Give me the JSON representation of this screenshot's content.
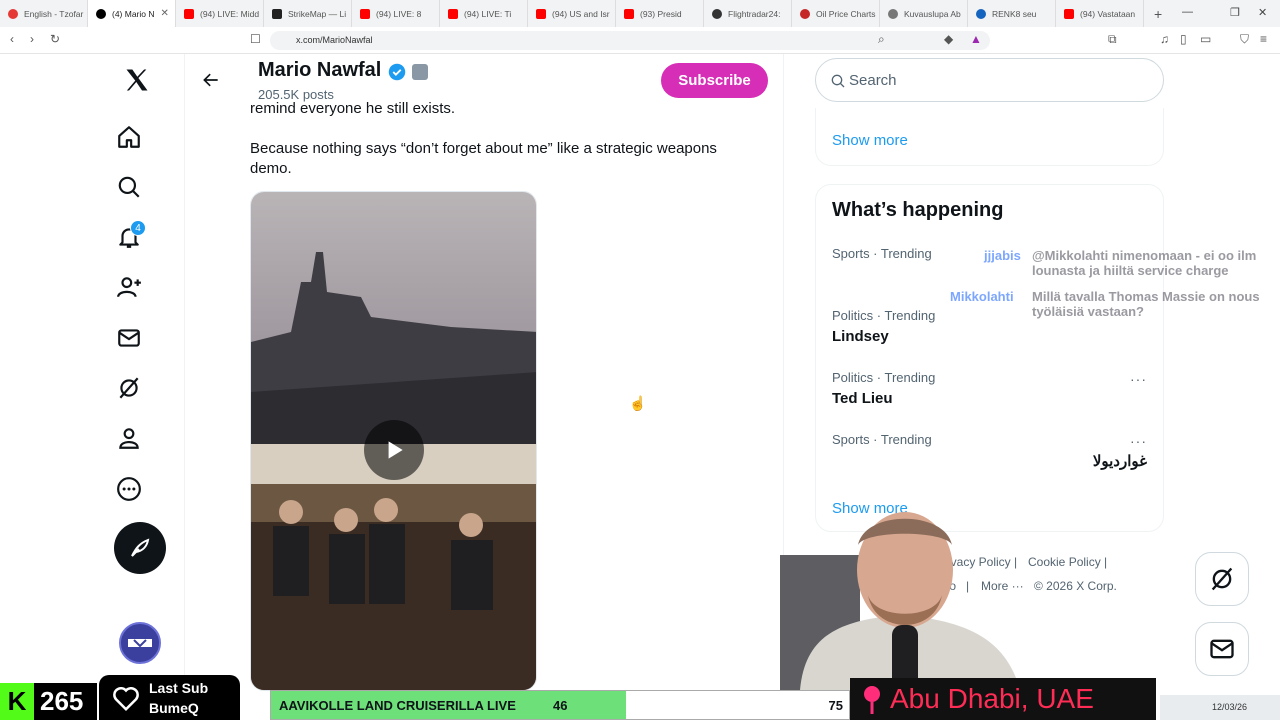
{
  "browser": {
    "tabs": [
      {
        "label": "English - Tzofar",
        "color": "#e53935"
      },
      {
        "label": "(4) Mario N",
        "color": "#000000",
        "active": true
      },
      {
        "label": "(94) LIVE: Midd",
        "color": "#ff0000"
      },
      {
        "label": "StrikeMap — Li",
        "color": "#222222"
      },
      {
        "label": "(94) LIVE: 8",
        "color": "#ff0000"
      },
      {
        "label": "(94) LIVE: Ti",
        "color": "#ff0000"
      },
      {
        "label": "(94) US and Isr",
        "color": "#ff0000"
      },
      {
        "label": "(93) Presid",
        "color": "#ff0000"
      },
      {
        "label": "Flightradar24:",
        "color": "#333333"
      },
      {
        "label": "Oil Price Charts",
        "color": "#c62828"
      },
      {
        "label": "Kuvauslupa Ab",
        "color": "#777777"
      },
      {
        "label": "RENK8 seu",
        "color": "#1565c0"
      },
      {
        "label": "(94) Vastataan",
        "color": "#ff0000"
      }
    ],
    "url": "x.com/MarioNawfal"
  },
  "profile": {
    "name": "Mario Nawfal",
    "posts": "205.5K posts",
    "subscribe_label": "Subscribe",
    "notif_count": "4"
  },
  "tweet": {
    "line1": "remind everyone he still exists.",
    "line2": "Because nothing says “don’t forget about me” like a strategic weapons demo."
  },
  "sidebar": {
    "search_placeholder": "Search",
    "show_more_top": "Show more",
    "whats_happening": "What’s happening",
    "trends": [
      {
        "meta": "Sports · Trending",
        "name": ""
      },
      {
        "meta": "Politics · Trending",
        "name": "Lindsey"
      },
      {
        "meta": "Politics · Trending",
        "name": "Ted Lieu"
      },
      {
        "meta": "Sports · Trending",
        "name": "غواردیولا"
      }
    ],
    "show_more_bottom": "Show more",
    "footer": {
      "privacy": "Privacy Policy",
      "cookie": "Cookie Policy",
      "info": "Info",
      "more": "More ···",
      "copyright": "© 2026 X Corp."
    }
  },
  "stream": {
    "chat": [
      {
        "user": "jjjabis",
        "text": "@Mikkolahti nimenomaan - ei oo ilm lounasta ja hiiltä service charge"
      },
      {
        "user": "Mikkolahti",
        "text": "Millä tavalla Thomas Massie on nous työläisiä vastaan?"
      }
    ],
    "sub_count": "265",
    "last_sub_label": "Last Sub",
    "last_sub_name": "BumeQ",
    "poll_title": "AAVIKOLLE LAND CRUISERILLA LIVE",
    "poll_left": "46",
    "poll_right": "75",
    "location": "Abu Dhabi, UAE",
    "date": "12/03/26"
  }
}
